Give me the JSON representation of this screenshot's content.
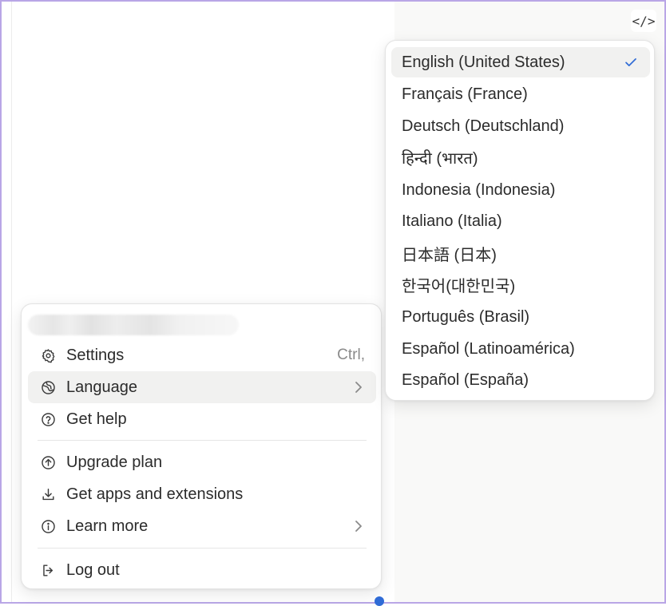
{
  "toolbar": {
    "code_toggle_glyph": "</>"
  },
  "account_menu": {
    "items": [
      {
        "label": "Settings",
        "shortcut": "Ctrl,"
      },
      {
        "label": "Language"
      },
      {
        "label": "Get help"
      },
      {
        "label": "Upgrade plan"
      },
      {
        "label": "Get apps and extensions"
      },
      {
        "label": "Learn more"
      },
      {
        "label": "Log out"
      }
    ],
    "hovered_item": "Language"
  },
  "language_menu": {
    "selected": "English (United States)",
    "items": [
      {
        "label": "English (United States)"
      },
      {
        "label": "Français (France)"
      },
      {
        "label": "Deutsch (Deutschland)"
      },
      {
        "label": "हिन्दी (भारत)"
      },
      {
        "label": "Indonesia (Indonesia)"
      },
      {
        "label": "Italiano (Italia)"
      },
      {
        "label": "日本語 (日本)"
      },
      {
        "label": "한국어(대한민국)"
      },
      {
        "label": "Português (Brasil)"
      },
      {
        "label": "Español (Latinoamérica)"
      },
      {
        "label": "Español (España)"
      }
    ]
  },
  "colors": {
    "accent_check": "#2f6bd6",
    "hover_bg": "#f1f1f0",
    "frame_border": "#b9a6e6"
  },
  "icons": {
    "settings": "gear-icon",
    "language": "globe-icon",
    "help": "help-circle-icon",
    "upgrade": "arrow-up-circle-icon",
    "apps": "download-icon",
    "learn": "info-circle-icon",
    "logout": "log-out-icon",
    "submenu": "chevron-right-icon",
    "selected": "checkmark-icon"
  }
}
